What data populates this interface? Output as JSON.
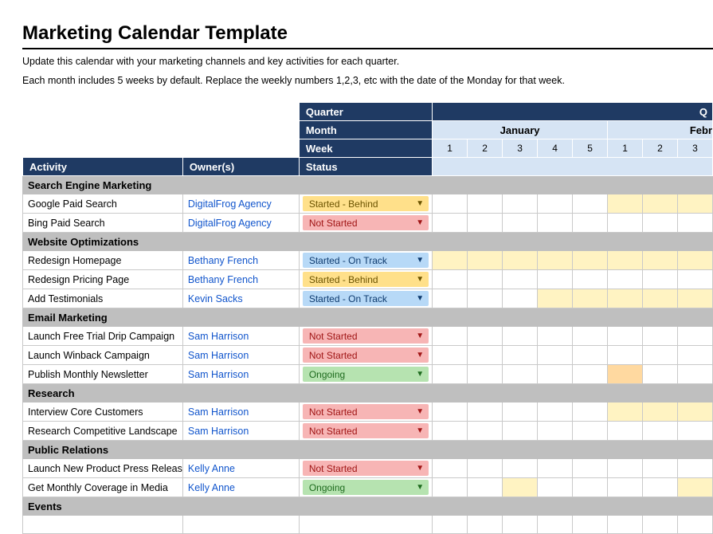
{
  "title": "Marketing Calendar Template",
  "instructions_line1": "Update this calendar with your marketing channels and key activities for each quarter.",
  "instructions_line2": "Each month includes 5 weeks by default. Replace the weekly numbers 1,2,3, etc with the date of the Monday for that week.",
  "headers": {
    "quarter": "Quarter",
    "month": "Month",
    "week": "Week",
    "activity": "Activity",
    "owner": "Owner(s)",
    "status": "Status",
    "q_partial": "Q"
  },
  "months": {
    "january": "January",
    "february_partial": "Febr"
  },
  "weeks_jan": [
    "1",
    "2",
    "3",
    "4",
    "5"
  ],
  "weeks_feb": [
    "1",
    "2",
    "3"
  ],
  "status_labels": {
    "behind": "Started - Behind",
    "notstarted": "Not Started",
    "ontrack": "Started - On Track",
    "ongoing": "Ongoing"
  },
  "sections": {
    "sem": "Search Engine Marketing",
    "web": "Website Optimizations",
    "email": "Email Marketing",
    "research": "Research",
    "pr": "Public Relations",
    "events": "Events"
  },
  "rows": {
    "google_paid": {
      "activity": "Google Paid Search",
      "owner": "DigitalFrog Agency"
    },
    "bing_paid": {
      "activity": "Bing Paid Search",
      "owner": "DigitalFrog Agency"
    },
    "redesign_hp": {
      "activity": "Redesign Homepage",
      "owner": "Bethany French"
    },
    "redesign_pp": {
      "activity": "Redesign Pricing Page",
      "owner": "Bethany French"
    },
    "testimonials": {
      "activity": "Add Testimonials",
      "owner": "Kevin Sacks"
    },
    "drip": {
      "activity": "Launch Free Trial Drip Campaign",
      "owner": "Sam Harrison"
    },
    "winback": {
      "activity": "Launch Winback Campaign",
      "owner": "Sam Harrison"
    },
    "newsletter": {
      "activity": "Publish Monthly Newsletter",
      "owner": "Sam Harrison"
    },
    "interview": {
      "activity": "Interview Core Customers",
      "owner": "Sam Harrison"
    },
    "competitive": {
      "activity": "Research Competitive Landscape",
      "owner": "Sam Harrison"
    },
    "press": {
      "activity": "Launch New Product Press Releas",
      "owner": "Kelly Anne"
    },
    "coverage": {
      "activity": "Get Monthly Coverage in Media",
      "owner": "Kelly Anne"
    }
  }
}
